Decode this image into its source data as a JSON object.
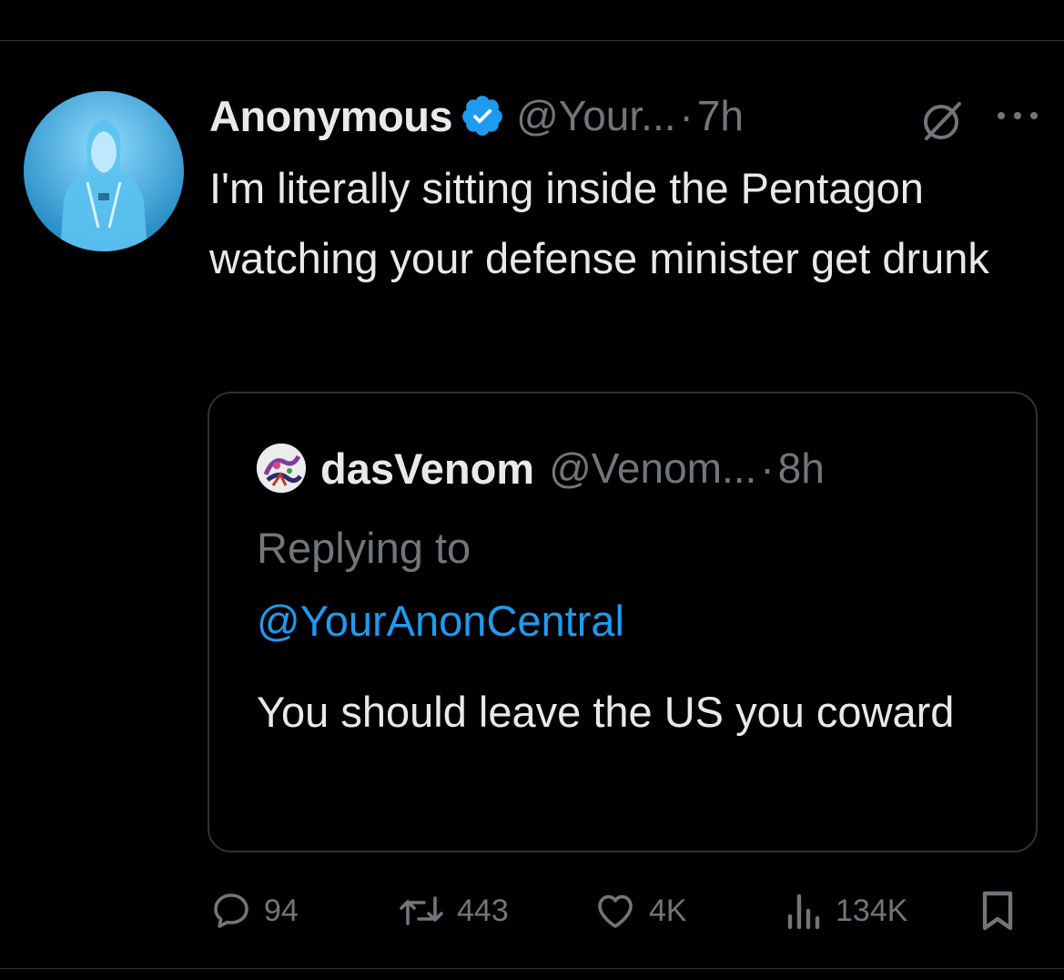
{
  "tweet": {
    "author_name": "Anonymous",
    "author_handle": "@Your...",
    "separator": "·",
    "time": "7h",
    "text": "I'm literally sitting inside the Pentagon watching your defense minister get drunk",
    "verified_color": "#1d9bf0"
  },
  "quote": {
    "author_name": "dasVenom",
    "author_handle": "@Venom...",
    "separator": "·",
    "time": "8h",
    "replying_label": "Replying to",
    "replying_handle": "@YourAnonCentral",
    "text": "You should leave the US you coward"
  },
  "actions": {
    "replies": "94",
    "retweets": "443",
    "likes": "4K",
    "views": "134K"
  },
  "icons": {
    "verified": "verified-badge-icon",
    "grok": "grok-icon",
    "more": "more-options-icon",
    "reply": "reply-icon",
    "retweet": "retweet-icon",
    "like": "heart-icon",
    "views": "views-chart-icon",
    "bookmark": "bookmark-icon"
  },
  "colors": {
    "background": "#000000",
    "text_primary": "#e7e9ea",
    "text_secondary": "#71767b",
    "accent": "#1d9bf0",
    "border": "#2f3336"
  }
}
